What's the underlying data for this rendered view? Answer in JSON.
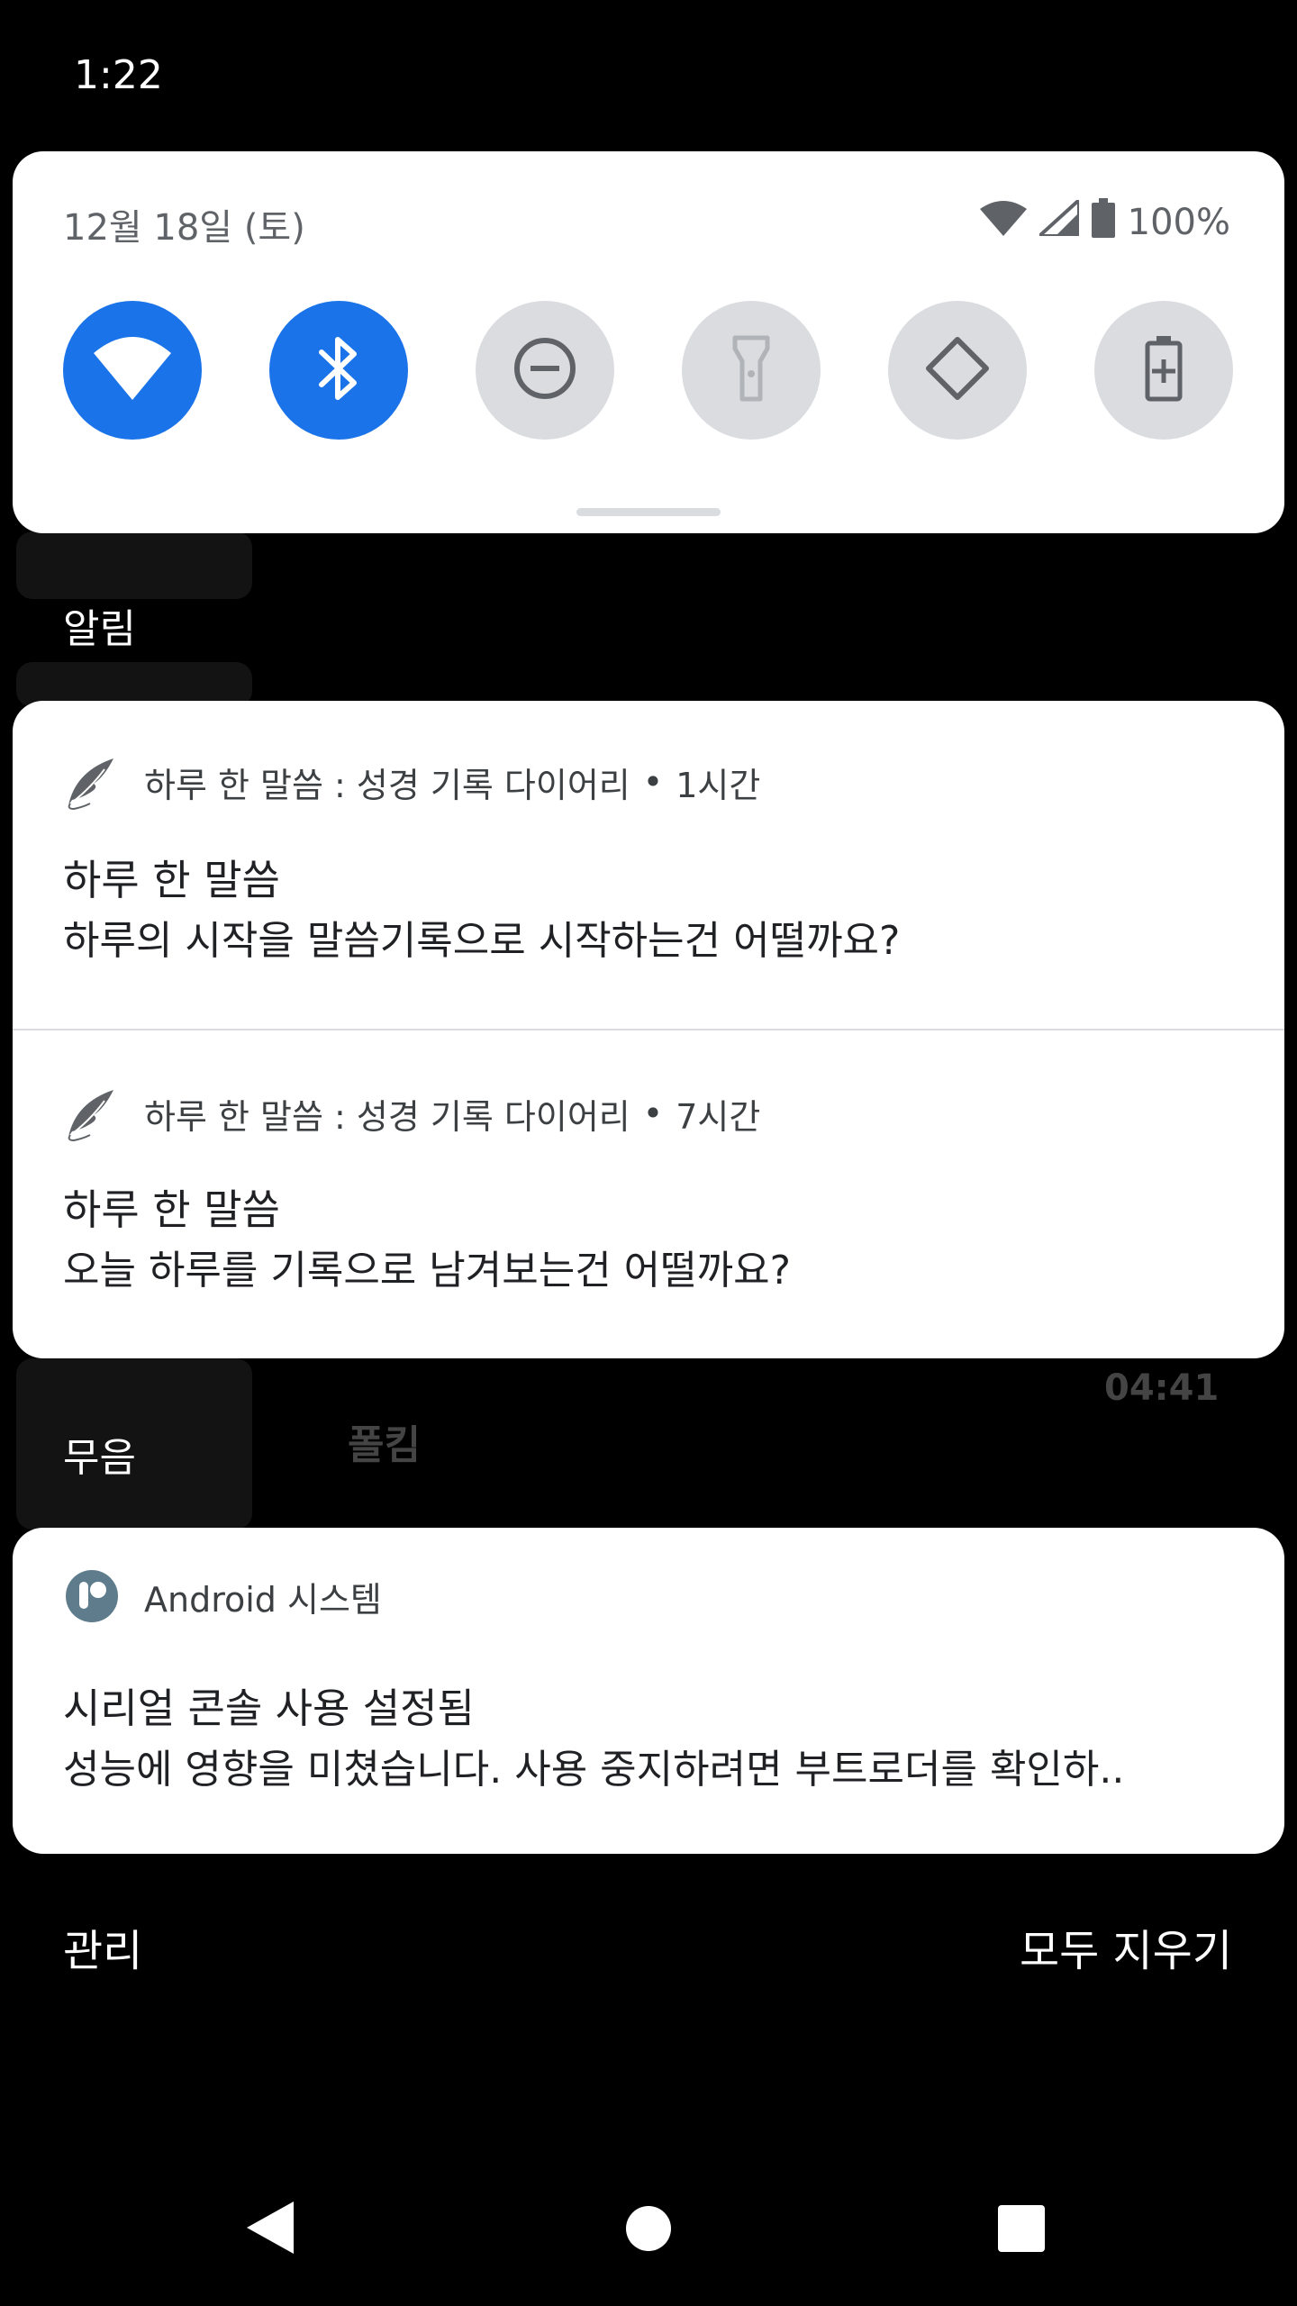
{
  "status_bar": {
    "time": "1:22"
  },
  "quick_settings": {
    "date": "12월 18일 (토)",
    "battery_percent": "100%",
    "tiles": [
      {
        "name": "wifi",
        "active": true
      },
      {
        "name": "bluetooth",
        "active": true
      },
      {
        "name": "do-not-disturb",
        "active": false
      },
      {
        "name": "flashlight",
        "active": false
      },
      {
        "name": "auto-rotate",
        "active": false
      },
      {
        "name": "battery-saver",
        "active": false
      }
    ]
  },
  "sections": {
    "alerting": "알림",
    "silent": "무음"
  },
  "background_media": {
    "artist": "폴킴",
    "duration": "04:41"
  },
  "notifications": [
    {
      "app": "하루 한 말씀 : 성경 기록 다이어리",
      "time": "1시간",
      "title": "하루 한 말씀",
      "text": "하루의 시작을 말씀기록으로 시작하는건 어떨까요?"
    },
    {
      "app": "하루 한 말씀 : 성경 기록 다이어리",
      "time": "7시간",
      "title": "하루 한 말씀",
      "text": "오늘 하루를 기록으로 남겨보는건 어떨까요?"
    }
  ],
  "system_notification": {
    "app": "Android 시스템",
    "title": "시리얼 콘솔 사용 설정됨",
    "text": "성능에 영향을 미쳤습니다. 사용 중지하려면 부트로더를 확인하.."
  },
  "footer": {
    "manage": "관리",
    "clear_all": "모두 지우기"
  },
  "colors": {
    "accent": "#1a73e8",
    "tile_off": "#dadce0",
    "icon_off": "#5f6368"
  }
}
